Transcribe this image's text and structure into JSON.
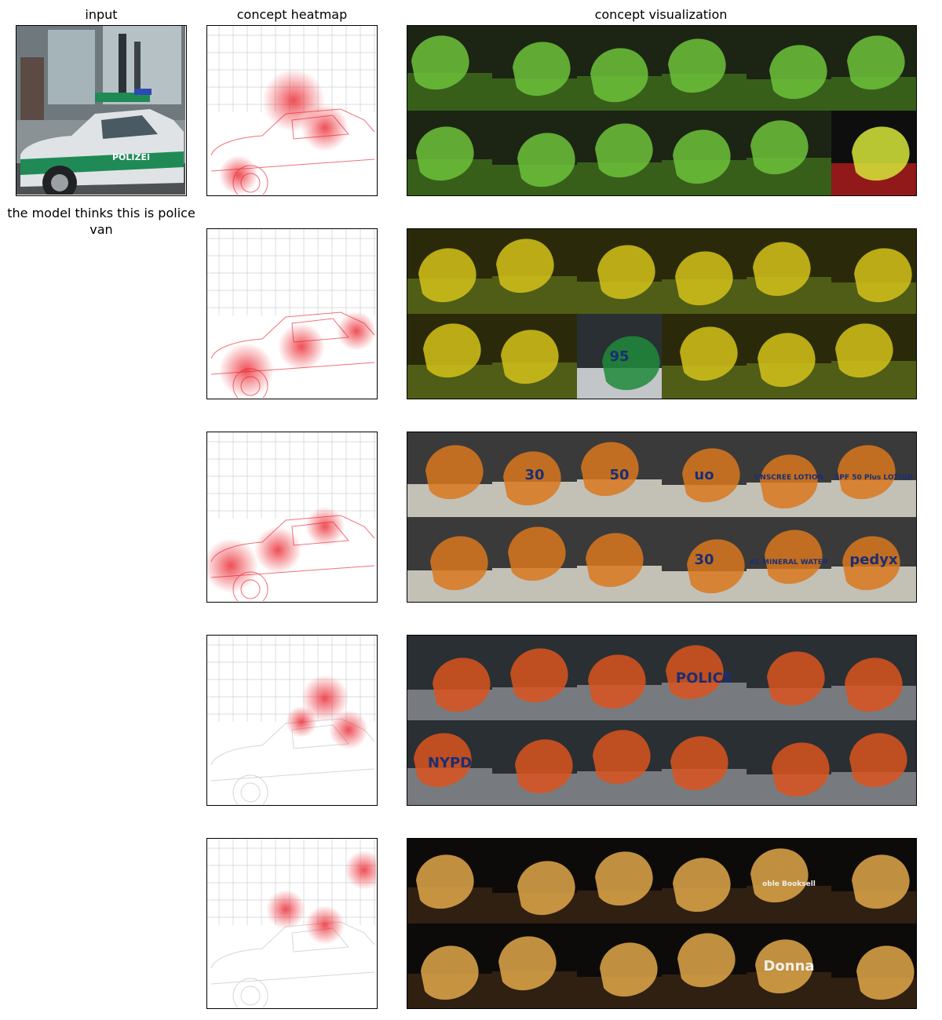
{
  "headers": {
    "input": "input",
    "heatmap": "concept heatmap",
    "visualization": "concept visualization"
  },
  "prediction_text": "the model thinks this is police van",
  "input_image": {
    "car_label": "POLIZEI"
  },
  "concept_rows": [
    {
      "tiles": [
        {
          "kind": "snake"
        },
        {
          "kind": "snake"
        },
        {
          "kind": "snake"
        },
        {
          "kind": "snake"
        },
        {
          "kind": "snake"
        },
        {
          "kind": "snake"
        },
        {
          "kind": "snake"
        },
        {
          "kind": "snake"
        },
        {
          "kind": "snake"
        },
        {
          "kind": "snake"
        },
        {
          "kind": "snake"
        },
        {
          "kind": "tennis"
        }
      ]
    },
    {
      "tiles": [
        {
          "kind": "field"
        },
        {
          "kind": "field"
        },
        {
          "kind": "field"
        },
        {
          "kind": "field"
        },
        {
          "kind": "field"
        },
        {
          "kind": "field"
        },
        {
          "kind": "field"
        },
        {
          "kind": "field"
        },
        {
          "kind": "racecar",
          "text": "95"
        },
        {
          "kind": "field"
        },
        {
          "kind": "field"
        },
        {
          "kind": "field"
        }
      ]
    },
    {
      "tiles": [
        {
          "kind": "bottle",
          "text": ""
        },
        {
          "kind": "bottle",
          "text": "30"
        },
        {
          "kind": "bottle",
          "text": "50"
        },
        {
          "kind": "bottle",
          "text": "uo"
        },
        {
          "kind": "bottle",
          "text": "UNSCREE LOTION"
        },
        {
          "kind": "bottle",
          "text": "SPF 50 Plus LOTION"
        },
        {
          "kind": "bottle",
          "text": ""
        },
        {
          "kind": "bottle",
          "text": ""
        },
        {
          "kind": "bottle",
          "text": ""
        },
        {
          "kind": "bottle",
          "text": "30"
        },
        {
          "kind": "bottle",
          "text": "AL MINERAL WATER"
        },
        {
          "kind": "bottle",
          "text": "pedyx"
        }
      ]
    },
    {
      "tiles": [
        {
          "kind": "vehicle"
        },
        {
          "kind": "vehicle"
        },
        {
          "kind": "vehicle"
        },
        {
          "kind": "vehicle",
          "text": "POLICE"
        },
        {
          "kind": "vehicle"
        },
        {
          "kind": "vehicle"
        },
        {
          "kind": "vehicle",
          "text": "NYPD"
        },
        {
          "kind": "vehicle"
        },
        {
          "kind": "vehicle"
        },
        {
          "kind": "vehicle"
        },
        {
          "kind": "vehicle"
        },
        {
          "kind": "vehicle"
        }
      ]
    },
    {
      "tiles": [
        {
          "kind": "night"
        },
        {
          "kind": "night"
        },
        {
          "kind": "night"
        },
        {
          "kind": "night"
        },
        {
          "kind": "night",
          "text": "oble Booksell"
        },
        {
          "kind": "night"
        },
        {
          "kind": "night"
        },
        {
          "kind": "night"
        },
        {
          "kind": "night"
        },
        {
          "kind": "night"
        },
        {
          "kind": "night",
          "text": "Donna"
        },
        {
          "kind": "night"
        }
      ]
    }
  ],
  "colors": {
    "heat": "#e8141e",
    "snake": "#6dc23a",
    "field": "#d4c21a",
    "police_green": "#1e8a5a"
  }
}
